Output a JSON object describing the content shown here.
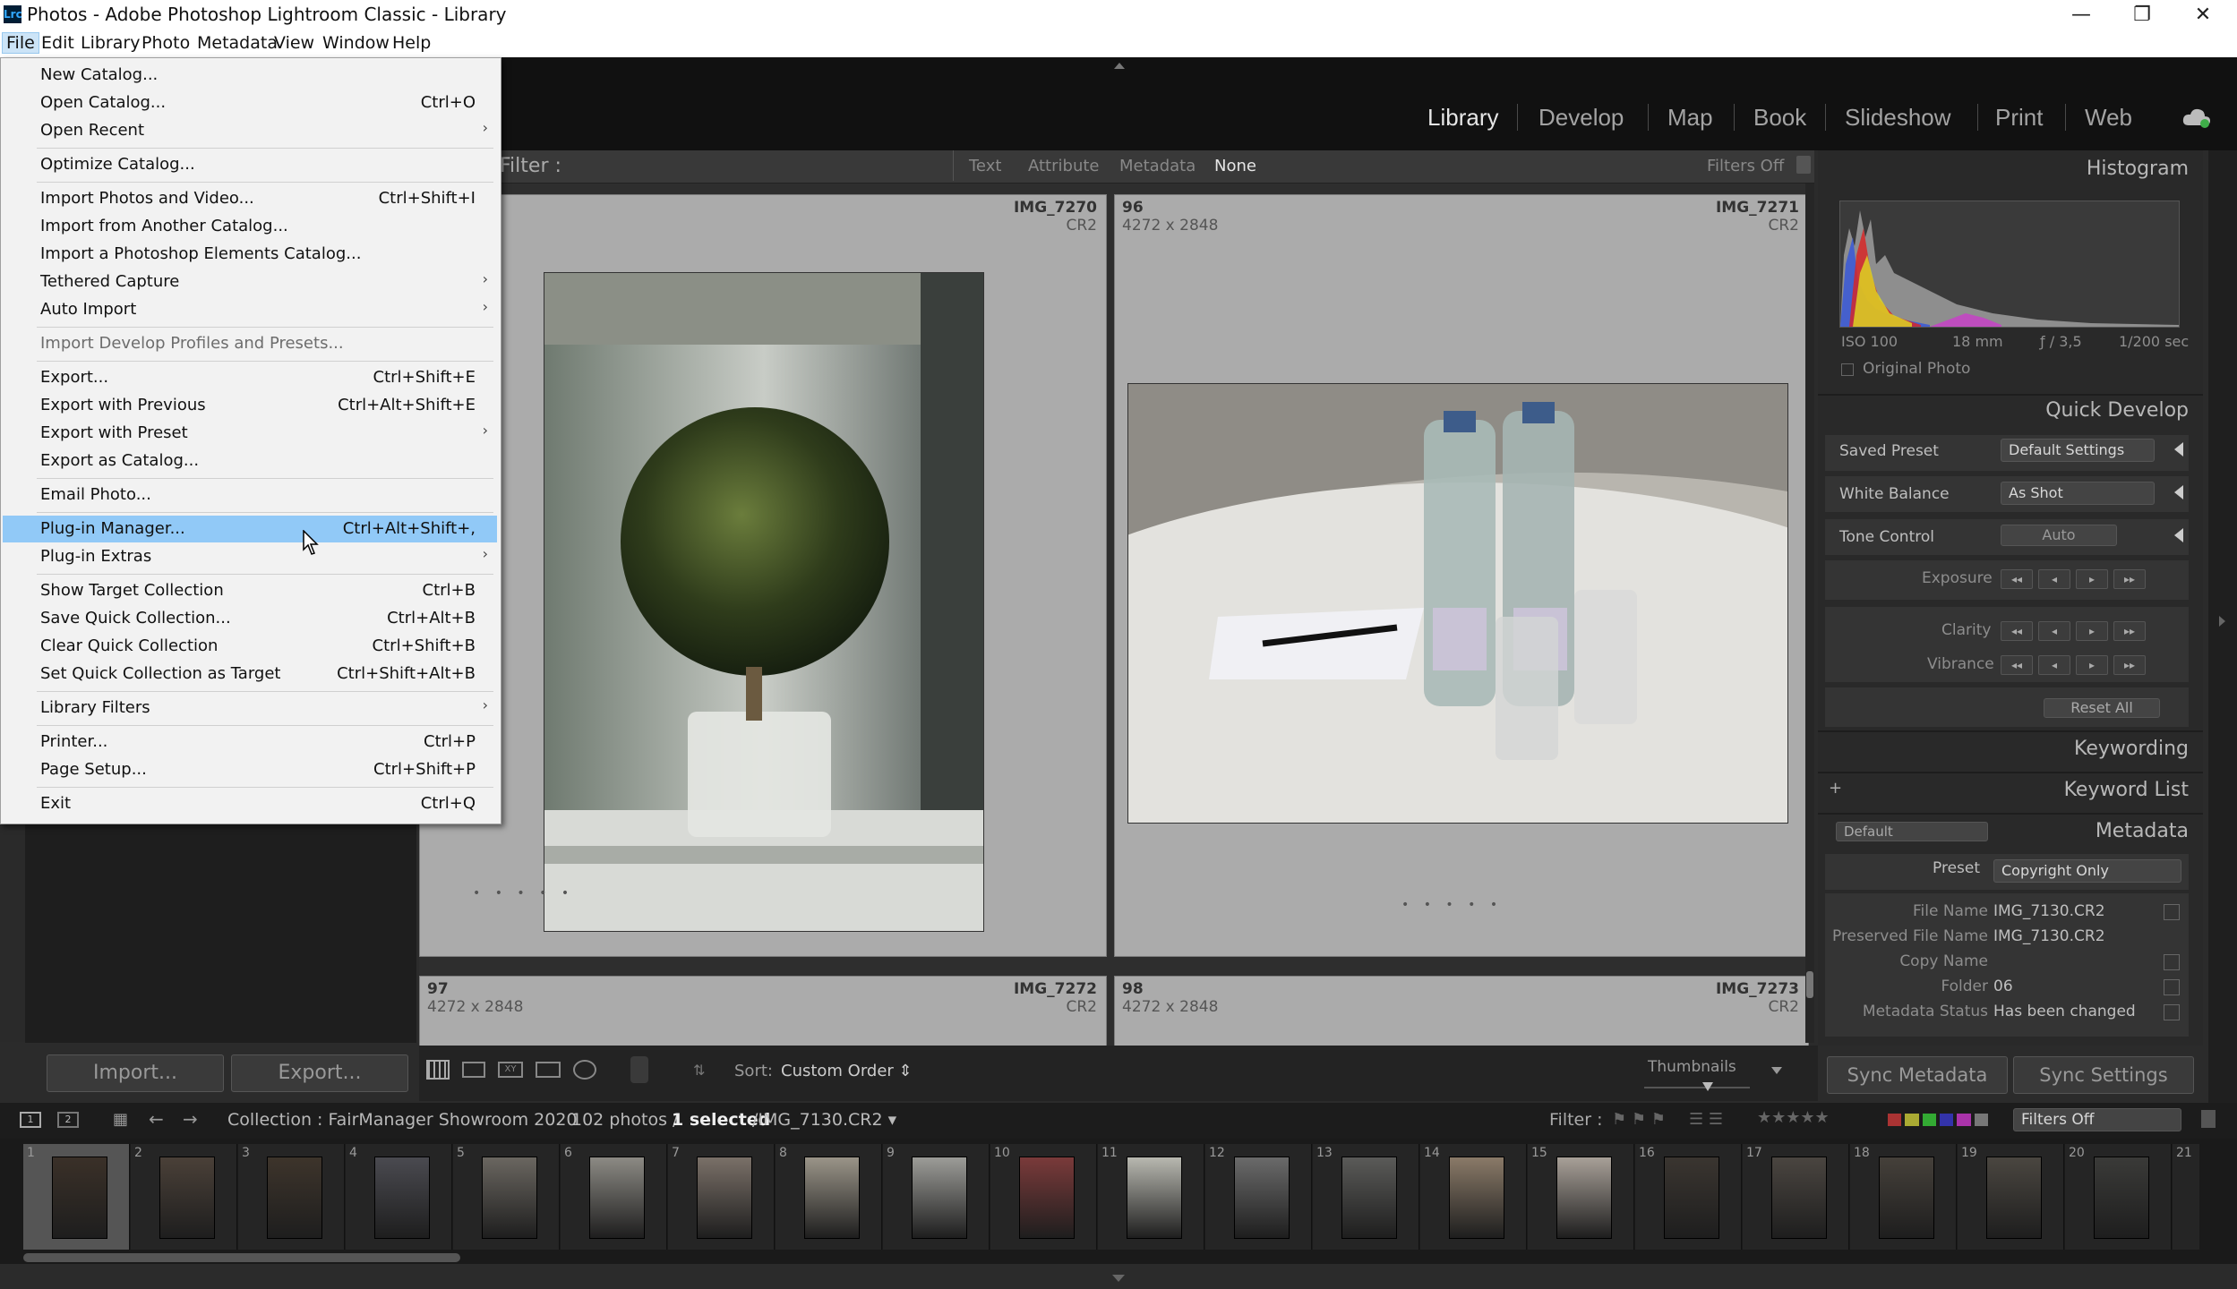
{
  "window": {
    "title": "Photos - Adobe Photoshop Lightroom Classic - Library",
    "app_badge": "Lrc",
    "controls": {
      "minimize": "—",
      "restore": "❐",
      "close": "✕"
    }
  },
  "menubar": [
    "File",
    "Edit",
    "Library",
    "Photo",
    "Metadata",
    "View",
    "Window",
    "Help"
  ],
  "modules": [
    "Library",
    "Develop",
    "Map",
    "Book",
    "Slideshow",
    "Print",
    "Web"
  ],
  "file_menu": {
    "groups": [
      [
        {
          "label": "New Catalog...",
          "key": ""
        },
        {
          "label": "Open Catalog...",
          "key": "Ctrl+O"
        },
        {
          "label": "Open Recent",
          "key": "",
          "submenu": true
        }
      ],
      [
        {
          "label": "Optimize Catalog...",
          "key": ""
        }
      ],
      [
        {
          "label": "Import Photos and Video...",
          "key": "Ctrl+Shift+I"
        },
        {
          "label": "Import from Another Catalog...",
          "key": ""
        },
        {
          "label": "Import a Photoshop Elements Catalog...",
          "key": ""
        },
        {
          "label": "Tethered Capture",
          "key": "",
          "submenu": true
        },
        {
          "label": "Auto Import",
          "key": "",
          "submenu": true
        }
      ],
      [
        {
          "label": "Import Develop Profiles and Presets...",
          "key": "",
          "disabled": true
        }
      ],
      [
        {
          "label": "Export...",
          "key": "Ctrl+Shift+E"
        },
        {
          "label": "Export with Previous",
          "key": "Ctrl+Alt+Shift+E"
        },
        {
          "label": "Export with Preset",
          "key": "",
          "submenu": true
        },
        {
          "label": "Export as Catalog...",
          "key": ""
        }
      ],
      [
        {
          "label": "Email Photo...",
          "key": ""
        }
      ],
      [
        {
          "label": "Plug-in Manager...",
          "key": "Ctrl+Alt+Shift+,",
          "highlighted": true
        },
        {
          "label": "Plug-in Extras",
          "key": "",
          "submenu": true
        }
      ],
      [
        {
          "label": "Show Target Collection",
          "key": "Ctrl+B"
        },
        {
          "label": "Save Quick Collection...",
          "key": "Ctrl+Alt+B"
        },
        {
          "label": "Clear Quick Collection",
          "key": "Ctrl+Shift+B"
        },
        {
          "label": "Set Quick Collection as Target",
          "key": "Ctrl+Shift+Alt+B"
        }
      ],
      [
        {
          "label": "Library Filters",
          "key": "",
          "submenu": true
        }
      ],
      [
        {
          "label": "Printer...",
          "key": "Ctrl+P"
        },
        {
          "label": "Page Setup...",
          "key": "Ctrl+Shift+P"
        }
      ],
      [
        {
          "label": "Exit",
          "key": "Ctrl+Q"
        }
      ]
    ]
  },
  "filter_bar": {
    "label": "Filter :",
    "tabs": [
      "Text",
      "Attribute",
      "Metadata",
      "None"
    ],
    "active_tab": "None",
    "filters_state": "Filters Off"
  },
  "grid": {
    "cells": [
      {
        "index": "",
        "name": "IMG_7270",
        "dims": "",
        "ext": "CR2",
        "partial": "2"
      },
      {
        "index": "96",
        "name": "IMG_7271",
        "dims": "4272 x 2848",
        "ext": "CR2"
      },
      {
        "index": "97",
        "name": "IMG_7272",
        "dims": "4272 x 2848",
        "ext": "CR2"
      },
      {
        "index": "98",
        "name": "IMG_7273",
        "dims": "4272 x 2848",
        "ext": "CR2"
      }
    ],
    "dots": "• • • • •"
  },
  "histogram": {
    "title": "Histogram",
    "iso": "ISO 100",
    "focal": "18 mm",
    "aperture": "ƒ / 3,5",
    "shutter": "1/200 sec",
    "original_photo": "Original Photo"
  },
  "quick_develop": {
    "title": "Quick Develop",
    "saved_preset_label": "Saved Preset",
    "saved_preset_value": "Default Settings",
    "white_balance_label": "White Balance",
    "white_balance_value": "As Shot",
    "tone_control_label": "Tone Control",
    "auto_label": "Auto",
    "exposure_label": "Exposure",
    "clarity_label": "Clarity",
    "vibrance_label": "Vibrance",
    "reset_label": "Reset All"
  },
  "keywording": {
    "title": "Keywording"
  },
  "keyword_list": {
    "title": "Keyword List",
    "add": "+"
  },
  "metadata": {
    "title": "Metadata",
    "view_select": "Default",
    "preset_label": "Preset",
    "preset_value": "Copyright Only",
    "fields": [
      {
        "label": "File Name",
        "value": "IMG_7130.CR2"
      },
      {
        "label": "Preserved File Name",
        "value": "IMG_7130.CR2"
      },
      {
        "label": "Copy Name",
        "value": ""
      },
      {
        "label": "Folder",
        "value": "06"
      },
      {
        "label": "Metadata Status",
        "value": "Has been changed"
      }
    ]
  },
  "buttons": {
    "import": "Import...",
    "export": "Export...",
    "sync_metadata": "Sync Metadata",
    "sync_settings": "Sync Settings"
  },
  "toolbar": {
    "sort_label": "Sort:",
    "sort_value": "Custom Order ⇕",
    "thumbnails_label": "Thumbnails",
    "thumbnail_size": 0.6
  },
  "filmstrip_header": {
    "screen1": "1",
    "screen2": "2",
    "collection": "Collection : FairManager Showroom 2020",
    "count": "102 photos /",
    "selected": "1 selected",
    "path": "/IMG_7130.CR2 ▾",
    "filter_label": "Filter :",
    "filters_select": "Filters Off",
    "stars": "★★★★★"
  },
  "filmstrip": {
    "numbers": [
      "1",
      "2",
      "3",
      "4",
      "5",
      "6",
      "7",
      "8",
      "9",
      "10",
      "11",
      "12",
      "13",
      "14",
      "15",
      "16",
      "17",
      "18",
      "19",
      "20",
      "21"
    ],
    "selected_index": 0
  },
  "colors": {
    "menu_highlight": "#91c9f7",
    "active_module": "#e6e6e6",
    "panel_bg": "#292929"
  }
}
